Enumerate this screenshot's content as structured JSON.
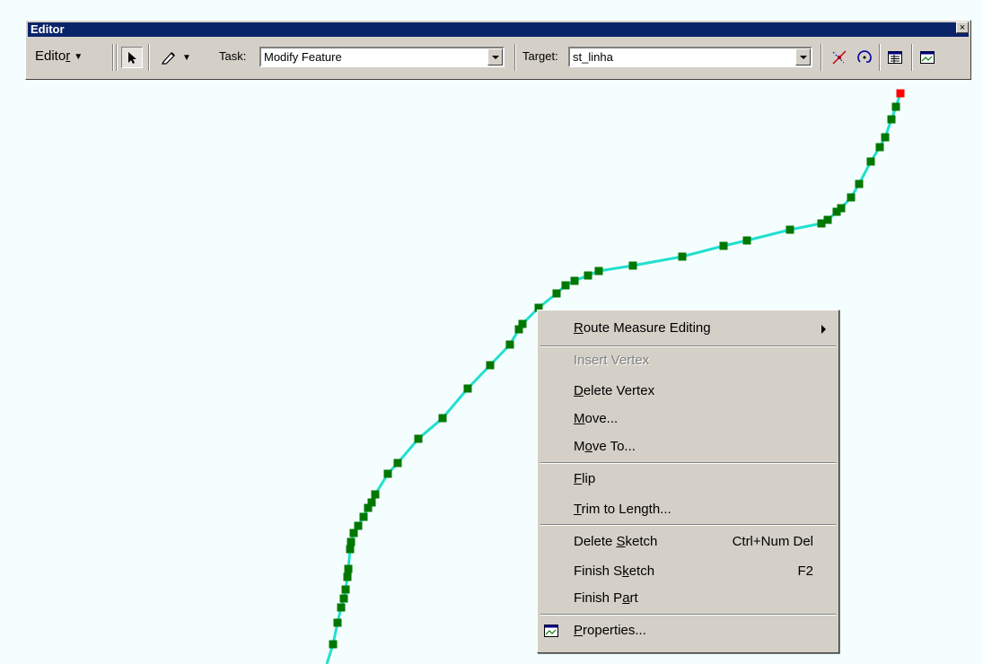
{
  "toolbar": {
    "title": "Editor",
    "close_glyph": "×",
    "editor_menu_pre": "Edito",
    "editor_menu_key": "r",
    "task_label": "Task:",
    "task_value": "Modify Feature",
    "target_label": "Target:",
    "target_value": "st_linha",
    "icons": [
      "arrow-pointer-icon",
      "pencil-icon",
      "sketch-vertex-icon",
      "rotate-icon",
      "attributes-icon",
      "properties-icon"
    ]
  },
  "context_menu": {
    "items": [
      {
        "key": "R",
        "rest": "oute Measure Editing",
        "shortcut": "",
        "submenu": true,
        "enabled": true
      },
      {
        "text": "Insert Vertex",
        "shortcut": "",
        "enabled": false
      },
      {
        "key": "D",
        "rest": "elete Vertex",
        "shortcut": "",
        "enabled": true
      },
      {
        "key": "M",
        "rest": "ove...",
        "shortcut": "",
        "enabled": true
      },
      {
        "pre": "M",
        "key": "o",
        "rest": "ve To...",
        "shortcut": "",
        "enabled": true
      },
      {
        "key": "F",
        "rest": "lip",
        "shortcut": "",
        "enabled": true
      },
      {
        "key": "T",
        "rest": "rim to Length...",
        "shortcut": "",
        "enabled": true
      },
      {
        "pre": "Delete ",
        "key": "S",
        "rest": "ketch",
        "shortcut": "Ctrl+Num Del",
        "enabled": true
      },
      {
        "pre": "Finish S",
        "key": "k",
        "rest": "etch",
        "shortcut": "F2",
        "enabled": true
      },
      {
        "pre": "Finish P",
        "key": "a",
        "rest": "rt",
        "shortcut": "",
        "enabled": true
      },
      {
        "key": "P",
        "rest": "roperties...",
        "shortcut": "",
        "enabled": true,
        "icon": "properties-icon"
      }
    ]
  },
  "colors": {
    "map_background": "#f4fefe",
    "line": "#20e0d0",
    "vertex": "#007800",
    "end_vertex": "#ff0000"
  }
}
